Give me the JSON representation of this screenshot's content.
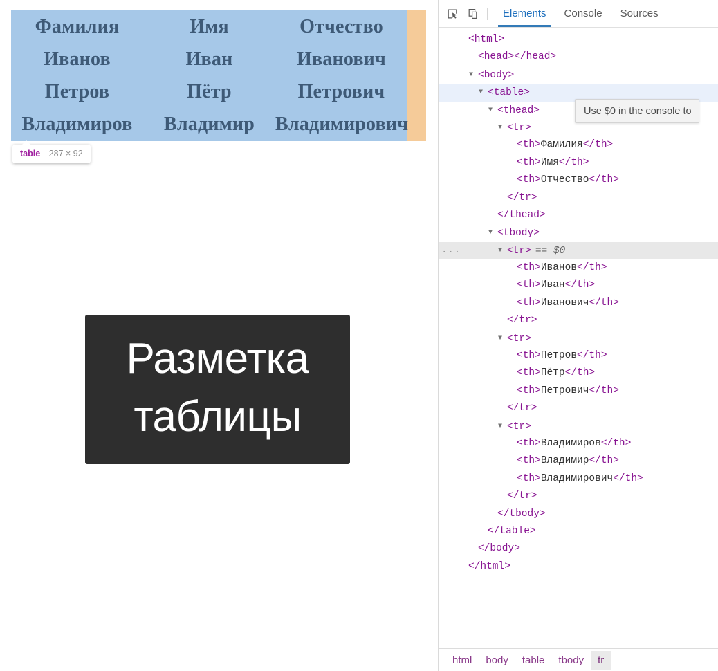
{
  "page": {
    "table": {
      "headers": [
        "Фамилия",
        "Имя",
        "Отчество"
      ],
      "rows": [
        [
          "Иванов",
          "Иван",
          "Иванович"
        ],
        [
          "Петров",
          "Пётр",
          "Петрович"
        ],
        [
          "Владимиров",
          "Владимир",
          "Владимирович"
        ]
      ]
    },
    "element_tooltip": {
      "tag": "table",
      "size": "287 × 92"
    },
    "caption": {
      "line1": "Разметка",
      "line2": "таблицы"
    },
    "highlight": {
      "content_color": "#a6c8e8",
      "margin_color": "#f5cb99",
      "text_color": "#3e5a77"
    }
  },
  "devtools": {
    "toolbar": {
      "inspect_icon": "inspect-element-icon",
      "device_icon": "device-toolbar-icon",
      "tabs": [
        {
          "label": "Elements",
          "active": true
        },
        {
          "label": "Console",
          "active": false
        },
        {
          "label": "Sources",
          "active": false
        }
      ],
      "active_tab_color": "#337ab7"
    },
    "dollar_tooltip": "Use $0 in the console to",
    "tree": [
      {
        "indent": 0,
        "twisty": "",
        "text": "<html>"
      },
      {
        "indent": 1,
        "twisty": "",
        "text": "<head></head>"
      },
      {
        "indent": 1,
        "twisty": "▼",
        "text": "<body>"
      },
      {
        "indent": 2,
        "twisty": "▼",
        "text": "<table>",
        "state": "sel-table"
      },
      {
        "indent": 3,
        "twisty": "▼",
        "text": "<thead>"
      },
      {
        "indent": 4,
        "twisty": "▼",
        "text": "<tr>"
      },
      {
        "indent": 5,
        "twisty": "",
        "tag_open": "<th>",
        "content": "Фамилия",
        "tag_close": "</th>"
      },
      {
        "indent": 5,
        "twisty": "",
        "tag_open": "<th>",
        "content": "Имя",
        "tag_close": "</th>"
      },
      {
        "indent": 5,
        "twisty": "",
        "tag_open": "<th>",
        "content": "Отчество",
        "tag_close": "</th>"
      },
      {
        "indent": 4,
        "twisty": "",
        "text": "</tr>"
      },
      {
        "indent": 3,
        "twisty": "",
        "text": "</thead>"
      },
      {
        "indent": 3,
        "twisty": "▼",
        "text": "<tbody>"
      },
      {
        "indent": 4,
        "twisty": "▼",
        "text": "<tr>",
        "dollar": "== $0",
        "state": "sel-tr",
        "dots": "..."
      },
      {
        "indent": 5,
        "twisty": "",
        "tag_open": "<th>",
        "content": "Иванов",
        "tag_close": "</th>"
      },
      {
        "indent": 5,
        "twisty": "",
        "tag_open": "<th>",
        "content": "Иван",
        "tag_close": "</th>"
      },
      {
        "indent": 5,
        "twisty": "",
        "tag_open": "<th>",
        "content": "Иванович",
        "tag_close": "</th>"
      },
      {
        "indent": 4,
        "twisty": "",
        "text": "</tr>"
      },
      {
        "indent": 4,
        "twisty": "▼",
        "text": "<tr>"
      },
      {
        "indent": 5,
        "twisty": "",
        "tag_open": "<th>",
        "content": "Петров",
        "tag_close": "</th>"
      },
      {
        "indent": 5,
        "twisty": "",
        "tag_open": "<th>",
        "content": "Пётр",
        "tag_close": "</th>"
      },
      {
        "indent": 5,
        "twisty": "",
        "tag_open": "<th>",
        "content": "Петрович",
        "tag_close": "</th>"
      },
      {
        "indent": 4,
        "twisty": "",
        "text": "</tr>"
      },
      {
        "indent": 4,
        "twisty": "▼",
        "text": "<tr>"
      },
      {
        "indent": 5,
        "twisty": "",
        "tag_open": "<th>",
        "content": "Владимиров",
        "tag_close": "</th>"
      },
      {
        "indent": 5,
        "twisty": "",
        "tag_open": "<th>",
        "content": "Владимир",
        "tag_close": "</th>"
      },
      {
        "indent": 5,
        "twisty": "",
        "tag_open": "<th>",
        "content": "Владимирович",
        "tag_close": "</th>"
      },
      {
        "indent": 4,
        "twisty": "",
        "text": "</tr>"
      },
      {
        "indent": 3,
        "twisty": "",
        "text": "</tbody>"
      },
      {
        "indent": 2,
        "twisty": "",
        "text": "</table>"
      },
      {
        "indent": 1,
        "twisty": "",
        "text": "</body>"
      },
      {
        "indent": 0,
        "twisty": "",
        "text": "</html>"
      }
    ],
    "breadcrumbs": [
      {
        "label": "html",
        "active": false
      },
      {
        "label": "body",
        "active": false
      },
      {
        "label": "table",
        "active": false
      },
      {
        "label": "tbody",
        "active": false
      },
      {
        "label": "tr",
        "active": true
      }
    ]
  }
}
